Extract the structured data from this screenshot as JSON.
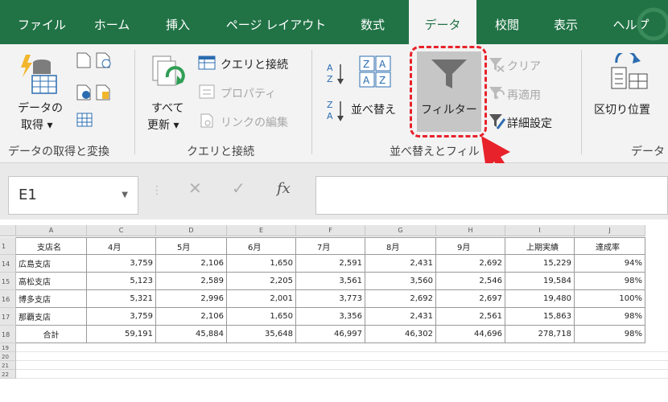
{
  "ribbon_tabs": [
    "ファイル",
    "ホーム",
    "挿入",
    "ページ レイアウト",
    "数式",
    "データ",
    "校閲",
    "表示",
    "ヘルプ"
  ],
  "active_tab": "データ",
  "groups": {
    "get_transform": {
      "label": "データの取得と変換",
      "get_data_line1": "データの",
      "get_data_line2": "取得 ▾"
    },
    "queries": {
      "label": "クエリと接続",
      "refresh_line1": "すべて",
      "refresh_line2": "更新 ▾",
      "queries_connections": "クエリと接続",
      "properties": "プロパティ",
      "edit_links": "リンクの編集"
    },
    "sort_filter": {
      "label": "並べ替えとフィル",
      "sort": "並べ替え",
      "filter": "フィルター",
      "clear": "クリア",
      "reapply": "再適用",
      "advanced": "詳細設定"
    },
    "data_tools": {
      "label": "データ",
      "text_to_columns": "区切り位置"
    }
  },
  "formula_bar": {
    "name_box": "E1",
    "fx": "fx",
    "formula": ""
  },
  "sheet": {
    "columns": [
      "A",
      "C",
      "D",
      "E",
      "F",
      "G",
      "H",
      "I",
      "J"
    ],
    "header_row": {
      "num": "1",
      "cells": [
        "支店名",
        "4月",
        "5月",
        "6月",
        "7月",
        "8月",
        "9月",
        "上期実績",
        "達成率"
      ]
    },
    "rows": [
      {
        "num": "14",
        "cells": [
          "広島支店",
          "3,759",
          "2,106",
          "1,650",
          "2,591",
          "2,431",
          "2,692",
          "15,229",
          "94%"
        ]
      },
      {
        "num": "15",
        "cells": [
          "高松支店",
          "5,123",
          "2,589",
          "2,205",
          "3,561",
          "3,560",
          "2,546",
          "19,584",
          "98%"
        ]
      },
      {
        "num": "16",
        "cells": [
          "博多支店",
          "5,321",
          "2,996",
          "2,001",
          "3,773",
          "2,692",
          "2,697",
          "19,480",
          "100%"
        ]
      },
      {
        "num": "17",
        "cells": [
          "那覇支店",
          "3,759",
          "2,106",
          "1,650",
          "3,356",
          "2,431",
          "2,561",
          "15,863",
          "98%"
        ]
      },
      {
        "num": "18",
        "cells": [
          "合計",
          "59,191",
          "45,884",
          "35,648",
          "46,997",
          "46,302",
          "44,696",
          "278,718",
          "98%"
        ]
      }
    ],
    "empty_rows": [
      "19",
      "20",
      "21",
      "22"
    ]
  },
  "colors": {
    "brand": "#217346",
    "highlight_border": "#e8222a",
    "selected_button": "#c6c6c6",
    "arrow": "#e8222a"
  }
}
